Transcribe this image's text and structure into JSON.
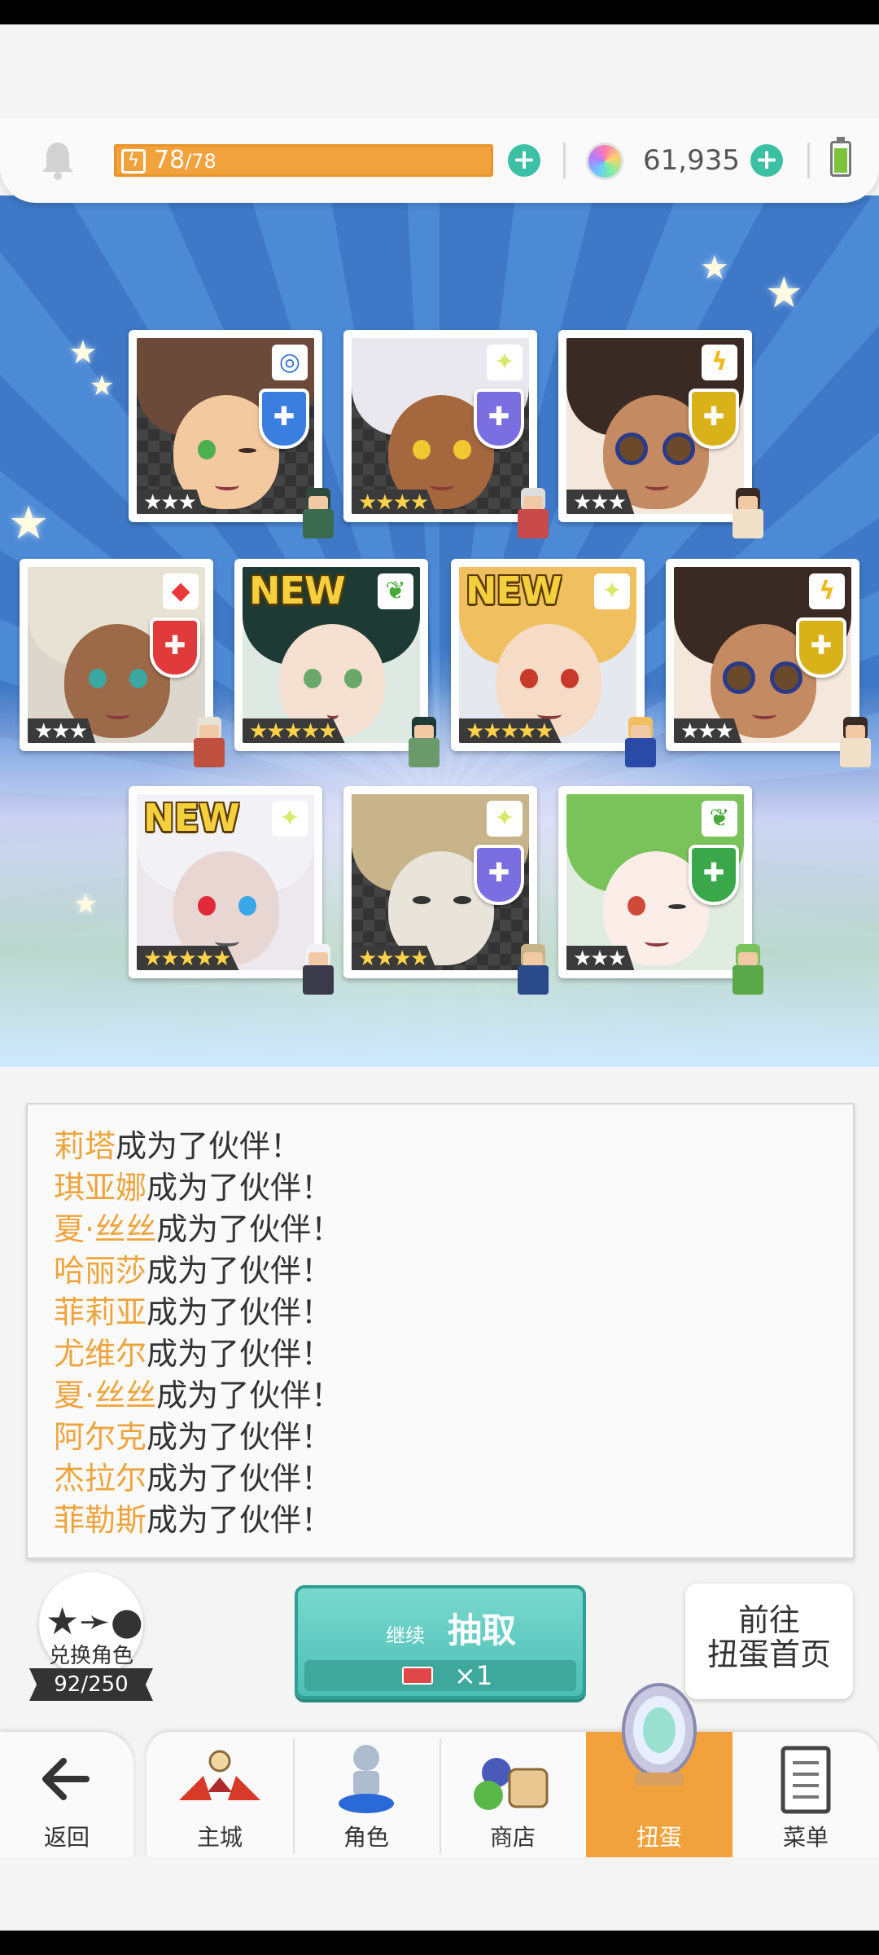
{
  "topbar": {
    "stamina_current": "78",
    "stamina_max": "/78",
    "gems": "61,935",
    "icons": {
      "bell": "bell-icon",
      "stamina": "lightning-icon",
      "gem": "rainbow-gem-icon",
      "battery": "battery-icon"
    }
  },
  "cards": [
    {
      "stars": "★★★",
      "element": "water",
      "new": false
    },
    {
      "stars": "★★★★",
      "element": "light",
      "new": false
    },
    {
      "stars": "★★★",
      "element": "thunder",
      "new": false
    },
    {
      "stars": "★★★",
      "element": "fire",
      "new": false
    },
    {
      "stars": "★★★★★",
      "element": "nature",
      "new": true,
      "new_label": "NEW"
    },
    {
      "stars": "★★★★★",
      "element": "light",
      "new": true,
      "new_label": "NEW"
    },
    {
      "stars": "★★★",
      "element": "thunder",
      "new": false
    },
    {
      "stars": "★★★★★",
      "element": "light",
      "new": true,
      "new_label": "NEW"
    },
    {
      "stars": "★★★★",
      "element": "light",
      "new": false
    },
    {
      "stars": "★★★",
      "element": "nature",
      "new": false
    }
  ],
  "messages": {
    "suffix": "成为了伙伴！",
    "names": [
      "莉塔",
      "琪亚娜",
      "夏·丝丝",
      "哈丽莎",
      "菲莉亚",
      "尤维尔",
      "夏·丝丝",
      "阿尔克",
      "杰拉尔",
      "菲勒斯"
    ]
  },
  "exchange": {
    "label": "兑换角色",
    "count": "92/250"
  },
  "pull_button": {
    "sub": "继续",
    "main": "抽取",
    "times": "×1"
  },
  "goto_button": {
    "line1": "前往",
    "line2": "扭蛋首页"
  },
  "nav": {
    "back": "返回",
    "items": [
      {
        "label": "主城",
        "icon": "castle-icon"
      },
      {
        "label": "角色",
        "icon": "character-icon"
      },
      {
        "label": "商店",
        "icon": "shop-icon"
      },
      {
        "label": "扭蛋",
        "icon": "gacha-mirror-icon",
        "active": true
      },
      {
        "label": "菜单",
        "icon": "menu-icon"
      }
    ]
  },
  "colors": {
    "accent_orange": "#f2a23d",
    "teal": "#4cbfb4",
    "name_highlight": "#eea43c"
  }
}
